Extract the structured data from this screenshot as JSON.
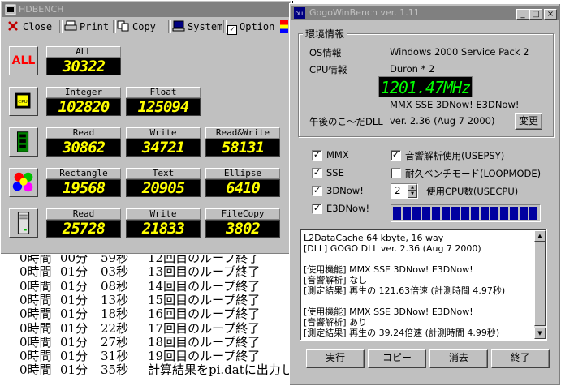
{
  "console_log": [
    {
      "t": "0時間",
      "m": "00分",
      "s": "59秒",
      "msg": "12回目のループ終了"
    },
    {
      "t": "0時間",
      "m": "01分",
      "s": "03秒",
      "msg": "13回目のループ終了"
    },
    {
      "t": "0時間",
      "m": "01分",
      "s": "08秒",
      "msg": "14回目のループ終了"
    },
    {
      "t": "0時間",
      "m": "01分",
      "s": "13秒",
      "msg": "15回目のループ終了"
    },
    {
      "t": "0時間",
      "m": "01分",
      "s": "18秒",
      "msg": "16回目のループ終了"
    },
    {
      "t": "0時間",
      "m": "01分",
      "s": "22秒",
      "msg": "17回目のループ終了"
    },
    {
      "t": "0時間",
      "m": "01分",
      "s": "27秒",
      "msg": "18回目のループ終了"
    },
    {
      "t": "0時間",
      "m": "01分",
      "s": "31秒",
      "msg": "19回目のループ終了"
    },
    {
      "t": "0時間",
      "m": "01分",
      "s": "35秒",
      "msg": "計算結果をpi.datに出力しました"
    }
  ],
  "hdbench": {
    "title": "HDBENCH",
    "toolbar": {
      "close": "Close",
      "print": "Print",
      "copy": "Copy",
      "system": "System",
      "option": "Option"
    },
    "all": {
      "label": "ALL",
      "header": "ALL",
      "value": "30322"
    },
    "cpu": {
      "integer_label": "Integer",
      "integer_value": "102820",
      "float_label": "Float",
      "float_value": "125094"
    },
    "memory": {
      "read_label": "Read",
      "read_value": "30862",
      "write_label": "Write",
      "write_value": "34721",
      "rw_label": "Read&Write",
      "rw_value": "58131"
    },
    "video": {
      "rect_label": "Rectangle",
      "rect_value": "19568",
      "text_label": "Text",
      "text_value": "20905",
      "ellipse_label": "Ellipse",
      "ellipse_value": "6410"
    },
    "drive": {
      "read_label": "Read",
      "read_value": "25728",
      "write_label": "Write",
      "write_value": "21833",
      "copy_label": "FileCopy",
      "copy_value": "3802"
    }
  },
  "gogo": {
    "title": "GogoWinBench ver. 1.11",
    "env_group": "環境情報",
    "os_label": "OS情報",
    "os_value": "Windows 2000 Service Pack 2",
    "cpu_label": "CPU情報",
    "cpu_value": "Duron * 2",
    "mhz": "1201.47MHz",
    "features": "MMX SSE 3DNow! E3DNow!",
    "dll_label": "午後のこ～だDLL",
    "dll_value": "ver. 2.36  (Aug  7 2000)",
    "change_button": "変更",
    "opt_mmx": "MMX",
    "opt_sse": "SSE",
    "opt_3dnow": "3DNow!",
    "opt_e3dnow": "E3DNow!",
    "opt_psy": "音響解析使用(USEPSY)",
    "opt_loop": "耐久ベンチモード(LOOPMODE)",
    "cpu_count": "2",
    "cpu_count_label": "使用CPU数(USECPU)",
    "progress": 1.0,
    "result_lines": [
      "L2DataCache 64 kbyte, 16 way",
      "[DLL] GOGO DLL ver. 2.36  (Aug  7 2000)",
      "",
      "[使用機能] MMX SSE 3DNow! E3DNow!",
      "[音響解析] なし",
      "[測定結果] 再生の 121.63倍速 (計測時間 4.97秒)",
      "",
      "[使用機能] MMX SSE 3DNow! E3DNow!",
      "[音響解析] あり",
      "[測定結果] 再生の 39.24倍速 (計測時間 4.99秒)"
    ],
    "buttons": {
      "run": "実行",
      "copy": "コピー",
      "clear": "消去",
      "exit": "終了"
    }
  },
  "colors": {
    "lcd_text": "#ffff00",
    "mhz_text": "#00ff00",
    "progress": "#0000a0"
  }
}
